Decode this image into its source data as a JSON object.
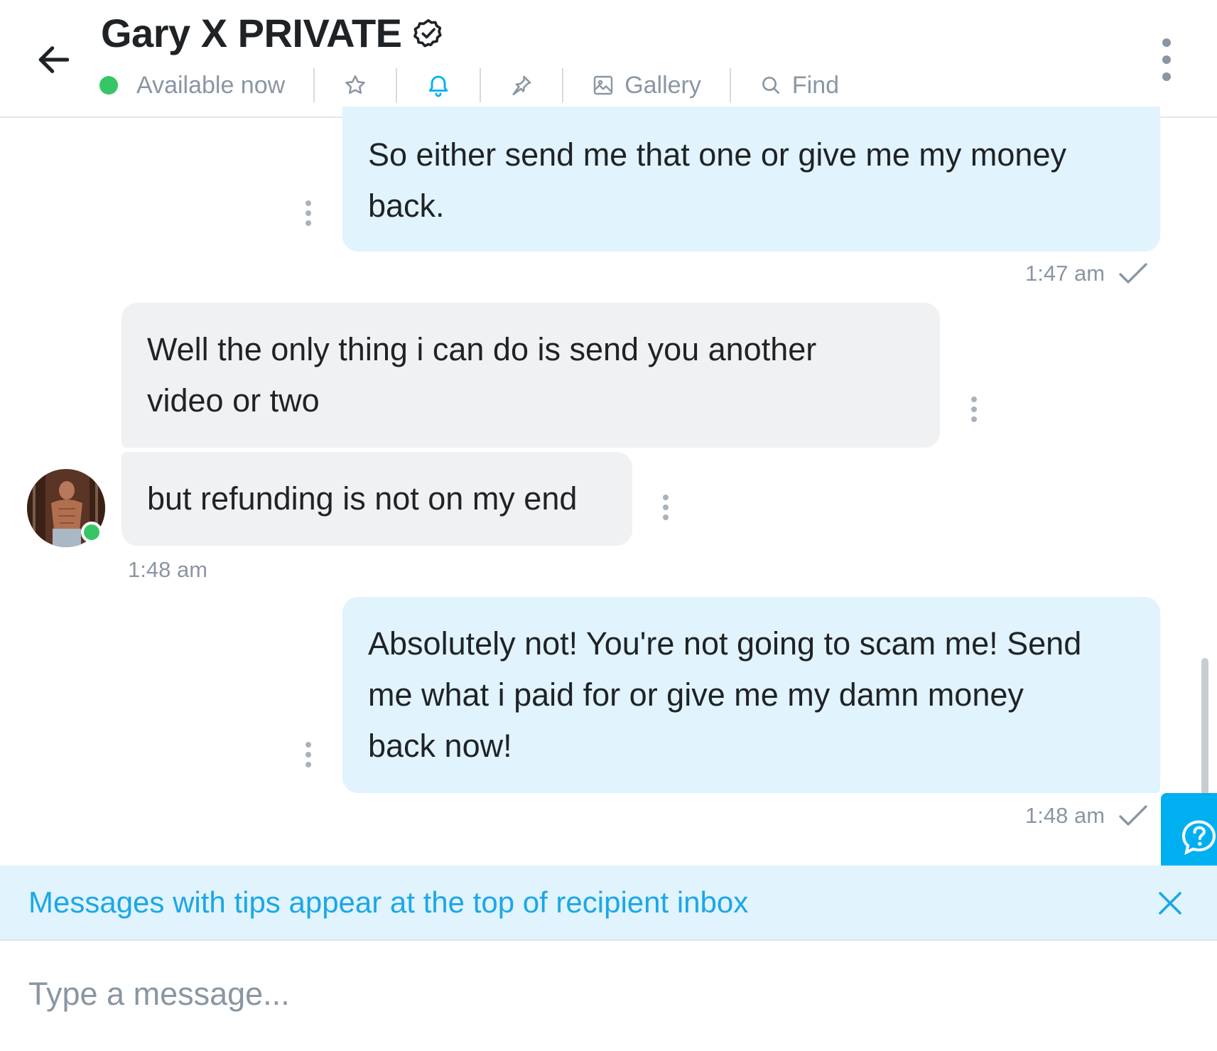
{
  "header": {
    "title": "Gary X PRIVATE",
    "status": "Available now",
    "gallery_label": "Gallery",
    "find_label": "Find"
  },
  "messages": [
    {
      "direction": "outgoing",
      "text_lines": [
        "So either send me that one or give me my money",
        "back."
      ],
      "time": "1:47 am"
    },
    {
      "direction": "incoming",
      "text_lines": [
        "Well the only thing i can do is send you another",
        "video or two"
      ]
    },
    {
      "direction": "incoming",
      "text_lines": [
        "but refunding is not on my end"
      ],
      "time": "1:48 am"
    },
    {
      "direction": "outgoing",
      "text_lines": [
        "Absolutely not! You're not going to scam me! Send",
        "me what i paid for or give me my damn money",
        "back now!"
      ],
      "time": "1:48 am"
    }
  ],
  "banner": {
    "text": "Messages with tips appear at the top of recipient inbox"
  },
  "composer": {
    "placeholder": "Type a message..."
  },
  "colors": {
    "accent": "#00aff0",
    "online": "#37c667",
    "outgoing_bubble": "#e1f3fc",
    "incoming_bubble": "#f0f1f3",
    "muted_text": "#8a96a3"
  },
  "icons": [
    "back-arrow-icon",
    "verified-icon",
    "star-icon",
    "bell-icon",
    "pin-icon",
    "gallery-icon",
    "search-icon",
    "more-vertical-icon",
    "check-icon",
    "help-icon",
    "close-icon"
  ]
}
